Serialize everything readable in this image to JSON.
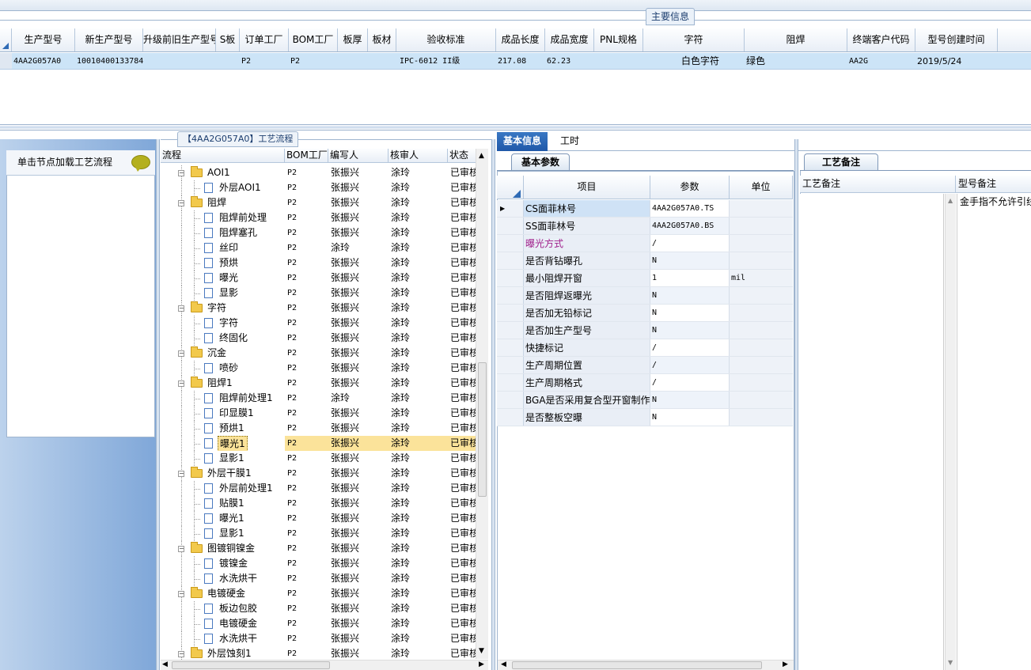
{
  "main_info": {
    "section_title": "主要信息",
    "columns": [
      "生产型号",
      "新生产型号",
      "升级前旧生产型号",
      "S板",
      "订单工厂",
      "BOM工厂",
      "板厚",
      "板材",
      "验收标准",
      "成品长度",
      "成品宽度",
      "PNL规格",
      "字符",
      "阻焊",
      "终端客户代码",
      "型号创建时间"
    ],
    "row": [
      "4AA2G057A0",
      "10010400133784",
      "",
      "",
      "P2",
      "P2",
      "",
      "",
      "IPC-6012 II级",
      "217.08",
      "62.23",
      "",
      "白色字符",
      "绿色",
      "AA2G",
      "2019/5/24"
    ]
  },
  "left_panel": {
    "header": "单击节点加载工艺流程"
  },
  "process_tree": {
    "title": "【4AA2G057A0】工艺流程",
    "columns": [
      "流程",
      "BOM工厂",
      "编写人",
      "核审人",
      "状态"
    ],
    "rows": [
      {
        "name": "AOI1",
        "level": 0,
        "folder": true,
        "bom": "P2",
        "writer": "张振兴",
        "reviewer": "涂玲",
        "status": "已审核"
      },
      {
        "name": "外层AOI1",
        "level": 1,
        "folder": false,
        "bom": "P2",
        "writer": "张振兴",
        "reviewer": "涂玲",
        "status": "已审核"
      },
      {
        "name": "阻焊",
        "level": 0,
        "folder": true,
        "bom": "P2",
        "writer": "张振兴",
        "reviewer": "涂玲",
        "status": "已审核"
      },
      {
        "name": "阻焊前处理",
        "level": 1,
        "folder": false,
        "bom": "P2",
        "writer": "张振兴",
        "reviewer": "涂玲",
        "status": "已审核"
      },
      {
        "name": "阻焊塞孔",
        "level": 1,
        "folder": false,
        "bom": "P2",
        "writer": "张振兴",
        "reviewer": "涂玲",
        "status": "已审核"
      },
      {
        "name": "丝印",
        "level": 1,
        "folder": false,
        "bom": "P2",
        "writer": "涂玲",
        "reviewer": "涂玲",
        "status": "已审核"
      },
      {
        "name": "预烘",
        "level": 1,
        "folder": false,
        "bom": "P2",
        "writer": "张振兴",
        "reviewer": "涂玲",
        "status": "已审核"
      },
      {
        "name": "曝光",
        "level": 1,
        "folder": false,
        "bom": "P2",
        "writer": "张振兴",
        "reviewer": "涂玲",
        "status": "已审核"
      },
      {
        "name": "显影",
        "level": 1,
        "folder": false,
        "bom": "P2",
        "writer": "张振兴",
        "reviewer": "涂玲",
        "status": "已审核"
      },
      {
        "name": "字符",
        "level": 0,
        "folder": true,
        "bom": "P2",
        "writer": "张振兴",
        "reviewer": "涂玲",
        "status": "已审核"
      },
      {
        "name": "字符",
        "level": 1,
        "folder": false,
        "bom": "P2",
        "writer": "张振兴",
        "reviewer": "涂玲",
        "status": "已审核"
      },
      {
        "name": "终固化",
        "level": 1,
        "folder": false,
        "bom": "P2",
        "writer": "张振兴",
        "reviewer": "涂玲",
        "status": "已审核"
      },
      {
        "name": "沉金",
        "level": 0,
        "folder": true,
        "bom": "P2",
        "writer": "张振兴",
        "reviewer": "涂玲",
        "status": "已审核"
      },
      {
        "name": "喷砂",
        "level": 1,
        "folder": false,
        "bom": "P2",
        "writer": "张振兴",
        "reviewer": "涂玲",
        "status": "已审核"
      },
      {
        "name": "阻焊1",
        "level": 0,
        "folder": true,
        "bom": "P2",
        "writer": "张振兴",
        "reviewer": "涂玲",
        "status": "已审核"
      },
      {
        "name": "阻焊前处理1",
        "level": 1,
        "folder": false,
        "bom": "P2",
        "writer": "涂玲",
        "reviewer": "涂玲",
        "status": "已审核"
      },
      {
        "name": "印显膜1",
        "level": 1,
        "folder": false,
        "bom": "P2",
        "writer": "张振兴",
        "reviewer": "涂玲",
        "status": "已审核"
      },
      {
        "name": "预烘1",
        "level": 1,
        "folder": false,
        "bom": "P2",
        "writer": "张振兴",
        "reviewer": "涂玲",
        "status": "已审核"
      },
      {
        "name": "曝光1",
        "level": 1,
        "folder": false,
        "bom": "P2",
        "writer": "张振兴",
        "reviewer": "涂玲",
        "status": "已审核",
        "selected": true
      },
      {
        "name": "显影1",
        "level": 1,
        "folder": false,
        "bom": "P2",
        "writer": "张振兴",
        "reviewer": "涂玲",
        "status": "已审核"
      },
      {
        "name": "外层干膜1",
        "level": 0,
        "folder": true,
        "bom": "P2",
        "writer": "张振兴",
        "reviewer": "涂玲",
        "status": "已审核"
      },
      {
        "name": "外层前处理1",
        "level": 1,
        "folder": false,
        "bom": "P2",
        "writer": "张振兴",
        "reviewer": "涂玲",
        "status": "已审核"
      },
      {
        "name": "贴膜1",
        "level": 1,
        "folder": false,
        "bom": "P2",
        "writer": "张振兴",
        "reviewer": "涂玲",
        "status": "已审核"
      },
      {
        "name": "曝光1",
        "level": 1,
        "folder": false,
        "bom": "P2",
        "writer": "张振兴",
        "reviewer": "涂玲",
        "status": "已审核"
      },
      {
        "name": "显影1",
        "level": 1,
        "folder": false,
        "bom": "P2",
        "writer": "张振兴",
        "reviewer": "涂玲",
        "status": "已审核"
      },
      {
        "name": "图镀铜镍金",
        "level": 0,
        "folder": true,
        "bom": "P2",
        "writer": "张振兴",
        "reviewer": "涂玲",
        "status": "已审核"
      },
      {
        "name": "镀镍金",
        "level": 1,
        "folder": false,
        "bom": "P2",
        "writer": "张振兴",
        "reviewer": "涂玲",
        "status": "已审核"
      },
      {
        "name": "水洗烘干",
        "level": 1,
        "folder": false,
        "bom": "P2",
        "writer": "张振兴",
        "reviewer": "涂玲",
        "status": "已审核"
      },
      {
        "name": "电镀硬金",
        "level": 0,
        "folder": true,
        "bom": "P2",
        "writer": "张振兴",
        "reviewer": "涂玲",
        "status": "已审核"
      },
      {
        "name": "板边包胶",
        "level": 1,
        "folder": false,
        "bom": "P2",
        "writer": "张振兴",
        "reviewer": "涂玲",
        "status": "已审核"
      },
      {
        "name": "电镀硬金",
        "level": 1,
        "folder": false,
        "bom": "P2",
        "writer": "张振兴",
        "reviewer": "涂玲",
        "status": "已审核"
      },
      {
        "name": "水洗烘干",
        "level": 1,
        "folder": false,
        "bom": "P2",
        "writer": "张振兴",
        "reviewer": "涂玲",
        "status": "已审核"
      },
      {
        "name": "外层蚀刻1",
        "level": 0,
        "folder": true,
        "bom": "P2",
        "writer": "张振兴",
        "reviewer": "涂玲",
        "status": "已审核"
      }
    ]
  },
  "tabs": {
    "basic": "基本信息",
    "hours": "工时"
  },
  "params": {
    "subtab": "基本参数",
    "columns": [
      "项目",
      "参数",
      "单位"
    ],
    "rows": [
      {
        "k": "CS面菲林号",
        "v": "4AA2G057A0.TS",
        "u": ""
      },
      {
        "k": "SS面菲林号",
        "v": "4AA2G057A0.BS",
        "u": ""
      },
      {
        "k": "曝光方式",
        "v": "/",
        "u": "",
        "highlight": true
      },
      {
        "k": "是否背钻曝孔",
        "v": "N",
        "u": ""
      },
      {
        "k": "最小阻焊开窗",
        "v": "1",
        "u": "mil"
      },
      {
        "k": "是否阻焊返曝光",
        "v": "N",
        "u": ""
      },
      {
        "k": "是否加无铅标记",
        "v": "N",
        "u": ""
      },
      {
        "k": "是否加生产型号",
        "v": "N",
        "u": ""
      },
      {
        "k": "快捷标记",
        "v": "/",
        "u": ""
      },
      {
        "k": "生产周期位置",
        "v": "/",
        "u": ""
      },
      {
        "k": "生产周期格式",
        "v": "/",
        "u": ""
      },
      {
        "k": "BGA是否采用复合型开窗制作",
        "v": "N",
        "u": ""
      },
      {
        "k": "是否整板空曝",
        "v": "N",
        "u": ""
      }
    ]
  },
  "remarks": {
    "subtab": "工艺备注",
    "col1": "工艺备注",
    "col2": "型号备注",
    "model_note": "金手指不允许引线"
  },
  "colors": {
    "selection": "#fbe39a",
    "row_highlight": "#cce4f7",
    "tab_active": "#1f58a8",
    "highlight_text": "#a0208c"
  }
}
